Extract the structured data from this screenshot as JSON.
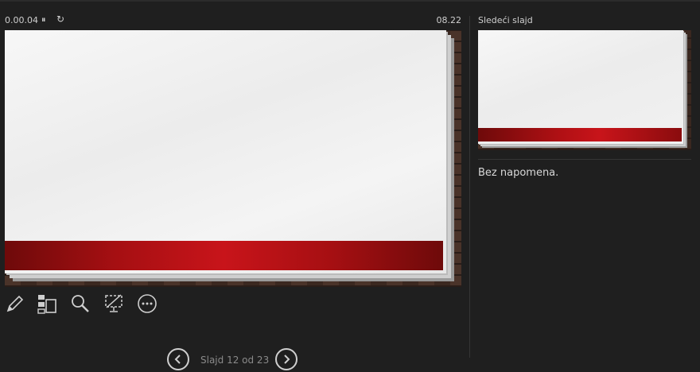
{
  "timer": {
    "elapsed": "0.00.04",
    "pause_glyph": "⏸",
    "restart_glyph": "↻",
    "clock": "08.22"
  },
  "tools": [
    {
      "icon": "pen-icon"
    },
    {
      "icon": "see-all-slides-icon"
    },
    {
      "icon": "zoom-icon"
    },
    {
      "icon": "black-screen-icon"
    },
    {
      "icon": "more-options-icon"
    }
  ],
  "nav": {
    "prev_icon": "chevron-left-icon",
    "slide_counter": "Slajd 12 od 23",
    "next_icon": "chevron-right-icon"
  },
  "next_slide": {
    "label": "Sledeći slajd"
  },
  "notes": {
    "text": "Bez napomena."
  },
  "colors": {
    "background": "#1f1f1f",
    "accent_red": "#c8141a",
    "text": "#d0d0d0"
  }
}
